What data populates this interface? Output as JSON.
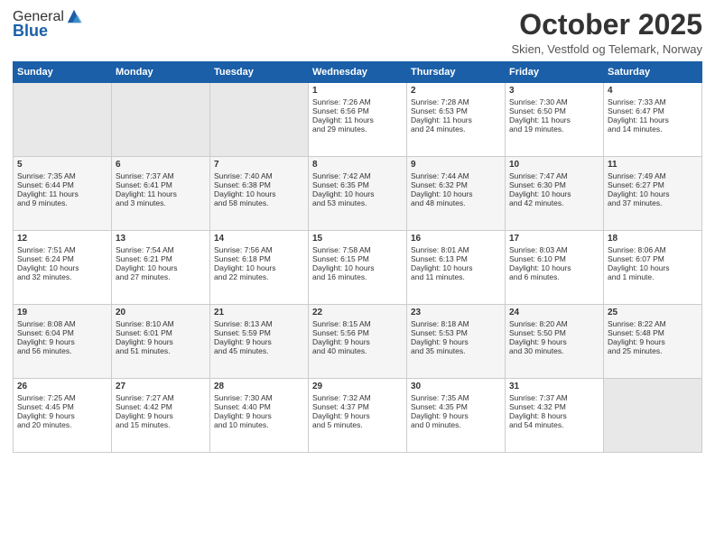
{
  "logo": {
    "general": "General",
    "blue": "Blue"
  },
  "header": {
    "month": "October 2025",
    "location": "Skien, Vestfold og Telemark, Norway"
  },
  "weekdays": [
    "Sunday",
    "Monday",
    "Tuesday",
    "Wednesday",
    "Thursday",
    "Friday",
    "Saturday"
  ],
  "weeks": [
    [
      {
        "day": "",
        "info": ""
      },
      {
        "day": "",
        "info": ""
      },
      {
        "day": "",
        "info": ""
      },
      {
        "day": "1",
        "info": "Sunrise: 7:26 AM\nSunset: 6:56 PM\nDaylight: 11 hours\nand 29 minutes."
      },
      {
        "day": "2",
        "info": "Sunrise: 7:28 AM\nSunset: 6:53 PM\nDaylight: 11 hours\nand 24 minutes."
      },
      {
        "day": "3",
        "info": "Sunrise: 7:30 AM\nSunset: 6:50 PM\nDaylight: 11 hours\nand 19 minutes."
      },
      {
        "day": "4",
        "info": "Sunrise: 7:33 AM\nSunset: 6:47 PM\nDaylight: 11 hours\nand 14 minutes."
      }
    ],
    [
      {
        "day": "5",
        "info": "Sunrise: 7:35 AM\nSunset: 6:44 PM\nDaylight: 11 hours\nand 9 minutes."
      },
      {
        "day": "6",
        "info": "Sunrise: 7:37 AM\nSunset: 6:41 PM\nDaylight: 11 hours\nand 3 minutes."
      },
      {
        "day": "7",
        "info": "Sunrise: 7:40 AM\nSunset: 6:38 PM\nDaylight: 10 hours\nand 58 minutes."
      },
      {
        "day": "8",
        "info": "Sunrise: 7:42 AM\nSunset: 6:35 PM\nDaylight: 10 hours\nand 53 minutes."
      },
      {
        "day": "9",
        "info": "Sunrise: 7:44 AM\nSunset: 6:32 PM\nDaylight: 10 hours\nand 48 minutes."
      },
      {
        "day": "10",
        "info": "Sunrise: 7:47 AM\nSunset: 6:30 PM\nDaylight: 10 hours\nand 42 minutes."
      },
      {
        "day": "11",
        "info": "Sunrise: 7:49 AM\nSunset: 6:27 PM\nDaylight: 10 hours\nand 37 minutes."
      }
    ],
    [
      {
        "day": "12",
        "info": "Sunrise: 7:51 AM\nSunset: 6:24 PM\nDaylight: 10 hours\nand 32 minutes."
      },
      {
        "day": "13",
        "info": "Sunrise: 7:54 AM\nSunset: 6:21 PM\nDaylight: 10 hours\nand 27 minutes."
      },
      {
        "day": "14",
        "info": "Sunrise: 7:56 AM\nSunset: 6:18 PM\nDaylight: 10 hours\nand 22 minutes."
      },
      {
        "day": "15",
        "info": "Sunrise: 7:58 AM\nSunset: 6:15 PM\nDaylight: 10 hours\nand 16 minutes."
      },
      {
        "day": "16",
        "info": "Sunrise: 8:01 AM\nSunset: 6:13 PM\nDaylight: 10 hours\nand 11 minutes."
      },
      {
        "day": "17",
        "info": "Sunrise: 8:03 AM\nSunset: 6:10 PM\nDaylight: 10 hours\nand 6 minutes."
      },
      {
        "day": "18",
        "info": "Sunrise: 8:06 AM\nSunset: 6:07 PM\nDaylight: 10 hours\nand 1 minute."
      }
    ],
    [
      {
        "day": "19",
        "info": "Sunrise: 8:08 AM\nSunset: 6:04 PM\nDaylight: 9 hours\nand 56 minutes."
      },
      {
        "day": "20",
        "info": "Sunrise: 8:10 AM\nSunset: 6:01 PM\nDaylight: 9 hours\nand 51 minutes."
      },
      {
        "day": "21",
        "info": "Sunrise: 8:13 AM\nSunset: 5:59 PM\nDaylight: 9 hours\nand 45 minutes."
      },
      {
        "day": "22",
        "info": "Sunrise: 8:15 AM\nSunset: 5:56 PM\nDaylight: 9 hours\nand 40 minutes."
      },
      {
        "day": "23",
        "info": "Sunrise: 8:18 AM\nSunset: 5:53 PM\nDaylight: 9 hours\nand 35 minutes."
      },
      {
        "day": "24",
        "info": "Sunrise: 8:20 AM\nSunset: 5:50 PM\nDaylight: 9 hours\nand 30 minutes."
      },
      {
        "day": "25",
        "info": "Sunrise: 8:22 AM\nSunset: 5:48 PM\nDaylight: 9 hours\nand 25 minutes."
      }
    ],
    [
      {
        "day": "26",
        "info": "Sunrise: 7:25 AM\nSunset: 4:45 PM\nDaylight: 9 hours\nand 20 minutes."
      },
      {
        "day": "27",
        "info": "Sunrise: 7:27 AM\nSunset: 4:42 PM\nDaylight: 9 hours\nand 15 minutes."
      },
      {
        "day": "28",
        "info": "Sunrise: 7:30 AM\nSunset: 4:40 PM\nDaylight: 9 hours\nand 10 minutes."
      },
      {
        "day": "29",
        "info": "Sunrise: 7:32 AM\nSunset: 4:37 PM\nDaylight: 9 hours\nand 5 minutes."
      },
      {
        "day": "30",
        "info": "Sunrise: 7:35 AM\nSunset: 4:35 PM\nDaylight: 9 hours\nand 0 minutes."
      },
      {
        "day": "31",
        "info": "Sunrise: 7:37 AM\nSunset: 4:32 PM\nDaylight: 8 hours\nand 54 minutes."
      },
      {
        "day": "",
        "info": ""
      }
    ]
  ]
}
